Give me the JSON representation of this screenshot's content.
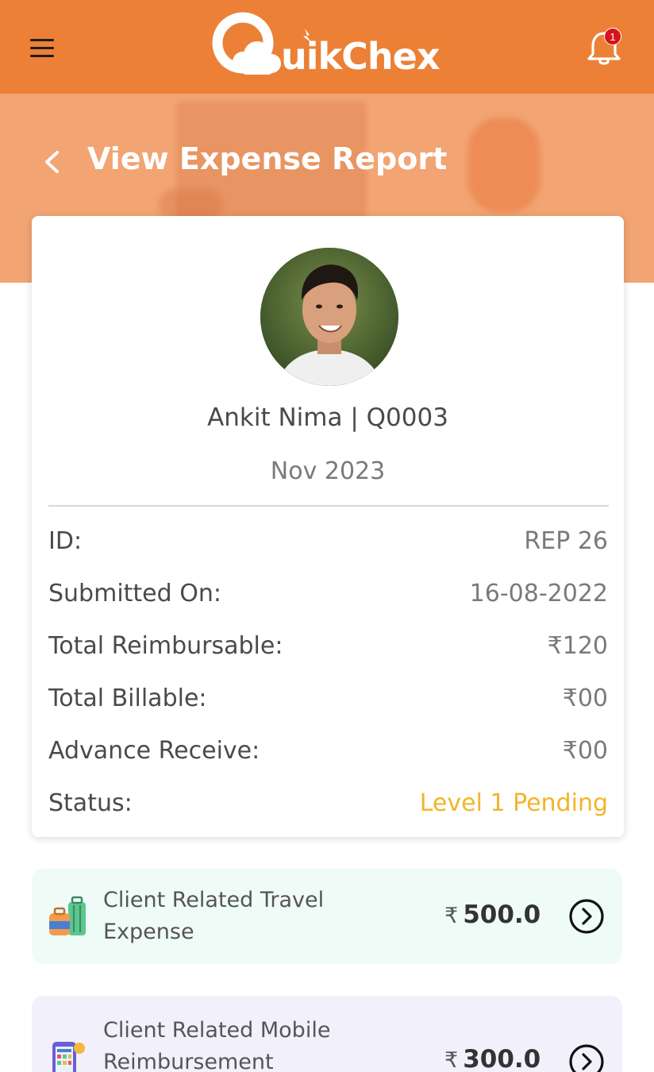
{
  "app": {
    "brand": "uikChex",
    "notification_count": "1"
  },
  "header": {
    "title": "View Expense Report"
  },
  "employee": {
    "name": "Ankit Nima | Q0003",
    "period": "Nov 2023"
  },
  "details": [
    {
      "label": "ID:",
      "value": "REP 26"
    },
    {
      "label": "Submitted On:",
      "value": "16-08-2022"
    },
    {
      "label": "Total Reimbursable:",
      "value": "₹120"
    },
    {
      "label": "Total Billable:",
      "value": "₹00"
    },
    {
      "label": "Advance Receive:",
      "value": "₹00"
    },
    {
      "label": "Status:",
      "value": "Level 1 Pending"
    }
  ],
  "categories": [
    {
      "label": "Client Related Travel Expense",
      "currency": "₹",
      "amount": "500.0",
      "icon": "luggage-icon"
    },
    {
      "label": "Client Related Mobile Reimbursement",
      "currency": "₹",
      "amount": "300.0",
      "icon": "mobile-bill-icon"
    }
  ],
  "colors": {
    "brand_orange": "#ec8036",
    "hero_orange": "#f2a473",
    "status_pending": "#f1b529",
    "notification_badge": "#d6141b",
    "travel_card_bg": "#effbf7",
    "mobile_card_bg": "#f2f0fb"
  }
}
